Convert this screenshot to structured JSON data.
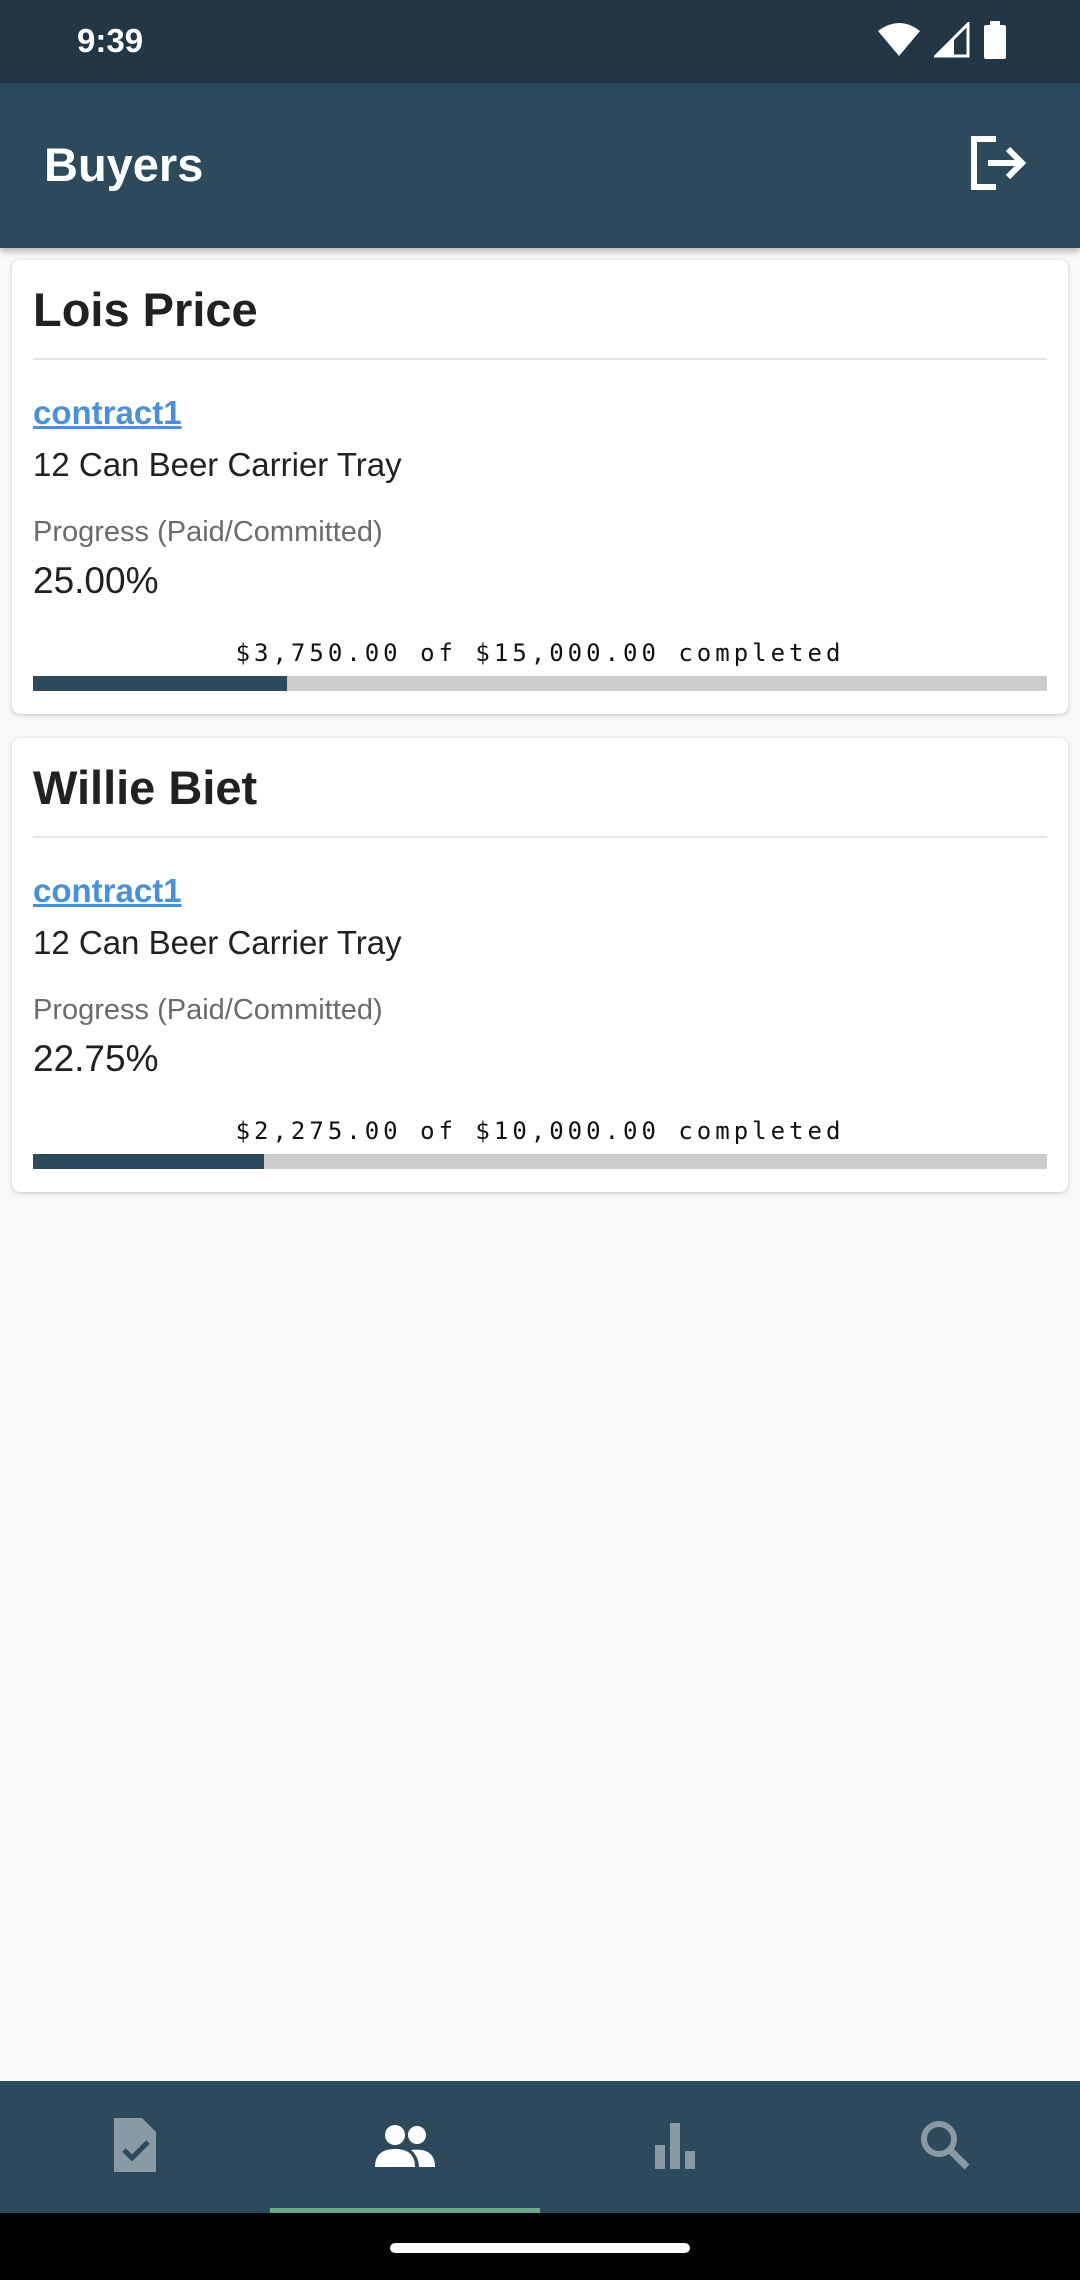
{
  "status_bar": {
    "time": "9:39"
  },
  "app_bar": {
    "title": "Buyers"
  },
  "buyers": [
    {
      "name": "Lois Price",
      "contract": "contract1",
      "product": "12 Can Beer Carrier Tray",
      "progress_label": "Progress (Paid/Committed)",
      "progress_value": "25.00%",
      "progress_fraction": 0.25,
      "progress_caption": "$3,750.00 of $15,000.00 completed"
    },
    {
      "name": "Willie Biet",
      "contract": "contract1",
      "product": "12 Can Beer Carrier Tray",
      "progress_label": "Progress (Paid/Committed)",
      "progress_value": "22.75%",
      "progress_fraction": 0.2275,
      "progress_caption": "$2,275.00 of $10,000.00 completed"
    }
  ],
  "bottom_nav": {
    "items": [
      {
        "icon": "contract-check-icon",
        "active": false
      },
      {
        "icon": "people-icon",
        "active": true
      },
      {
        "icon": "bar-chart-icon",
        "active": false
      },
      {
        "icon": "search-icon",
        "active": false
      }
    ]
  },
  "colors": {
    "status_bar": "#223646",
    "app_bar": "#2c4a5b",
    "link": "#4a90d9",
    "progress_fill": "#2c4a5b",
    "progress_track": "#cccccc",
    "nav_active_indicator": "#6aa88a",
    "nav_icon_inactive": "#8a9aa4"
  }
}
